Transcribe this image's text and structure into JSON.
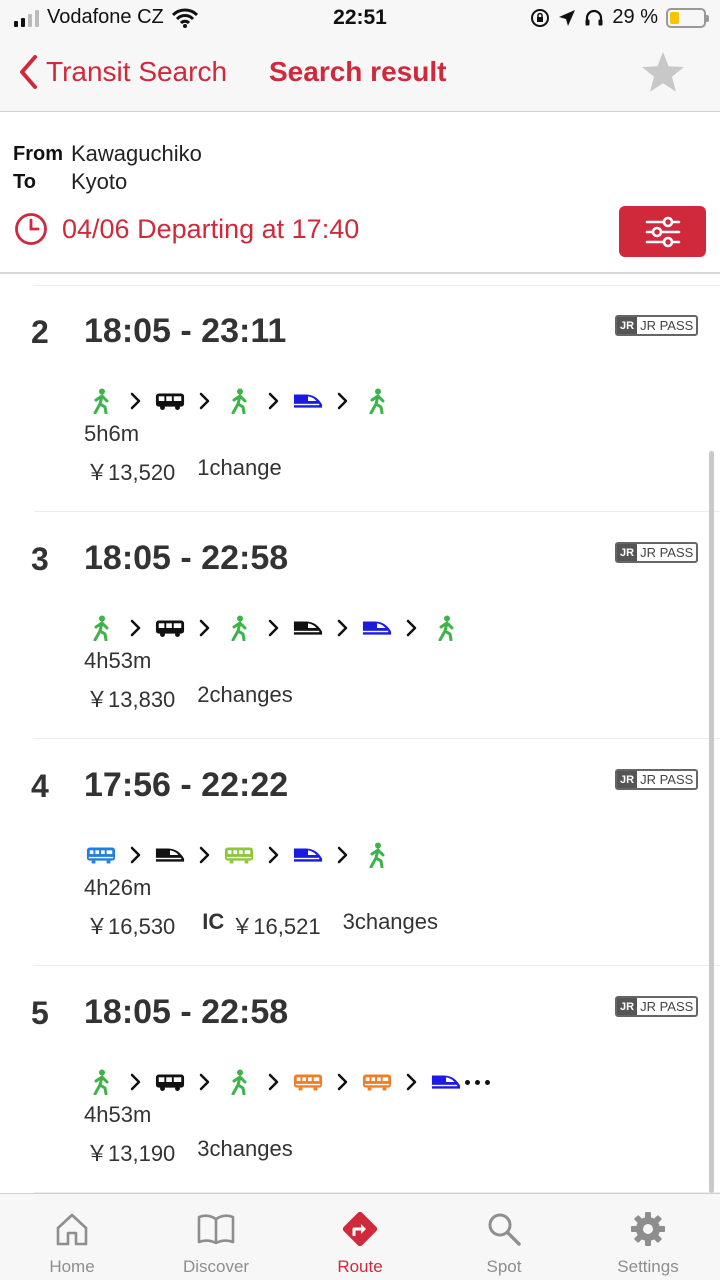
{
  "status_bar": {
    "carrier": "Vodafone CZ",
    "time": "22:51",
    "battery_percent": "29 %",
    "battery_level": 0.29
  },
  "nav": {
    "back_label": "Transit Search",
    "title": "Search result"
  },
  "search": {
    "from_label": "From",
    "from_value": "Kawaguchiko",
    "to_label": "To",
    "to_value": "Kyoto",
    "departure": "04/06 Departing at 17:40"
  },
  "badge": {
    "jr": "JR",
    "pass": "JR PASS"
  },
  "routes": [
    {
      "number": "2",
      "time": "18:05 - 23:11",
      "legs": [
        "walk",
        "bus",
        "walk",
        "shinkansen-blue",
        "walk"
      ],
      "duration": "5h6m",
      "fare": "￥13,520",
      "changes": "1change"
    },
    {
      "number": "3",
      "time": "18:05 - 22:58",
      "legs": [
        "walk",
        "bus",
        "walk",
        "shinkansen-black",
        "shinkansen-blue",
        "walk"
      ],
      "duration": "4h53m",
      "fare": "￥13,830",
      "changes": "2changes"
    },
    {
      "number": "4",
      "time": "17:56 - 22:22",
      "legs": [
        "train-blue",
        "shinkansen-black",
        "train-green",
        "shinkansen-blue",
        "walk"
      ],
      "duration": "4h26m",
      "fare": "￥16,530",
      "ic_label": "IC",
      "ic_fare": "￥16,521",
      "changes": "3changes"
    },
    {
      "number": "5",
      "time": "18:05 - 22:58",
      "legs": [
        "walk",
        "bus",
        "walk",
        "train-orange",
        "train-orange",
        "shinkansen-blue"
      ],
      "more": true,
      "duration": "4h53m",
      "fare": "￥13,190",
      "changes": "3changes"
    }
  ],
  "tabs": [
    {
      "label": "Home",
      "icon": "home-icon"
    },
    {
      "label": "Discover",
      "icon": "book-icon"
    },
    {
      "label": "Route",
      "icon": "route-icon",
      "active": true
    },
    {
      "label": "Spot",
      "icon": "search-icon"
    },
    {
      "label": "Settings",
      "icon": "gear-icon"
    }
  ],
  "colors": {
    "accent": "#d0293b",
    "walk": "#3db34a",
    "shinkansen_blue": "#1a1ae0",
    "train_blue": "#1e7fe0",
    "train_green": "#8cc63f",
    "train_orange": "#f47c20",
    "bus": "#111111"
  }
}
